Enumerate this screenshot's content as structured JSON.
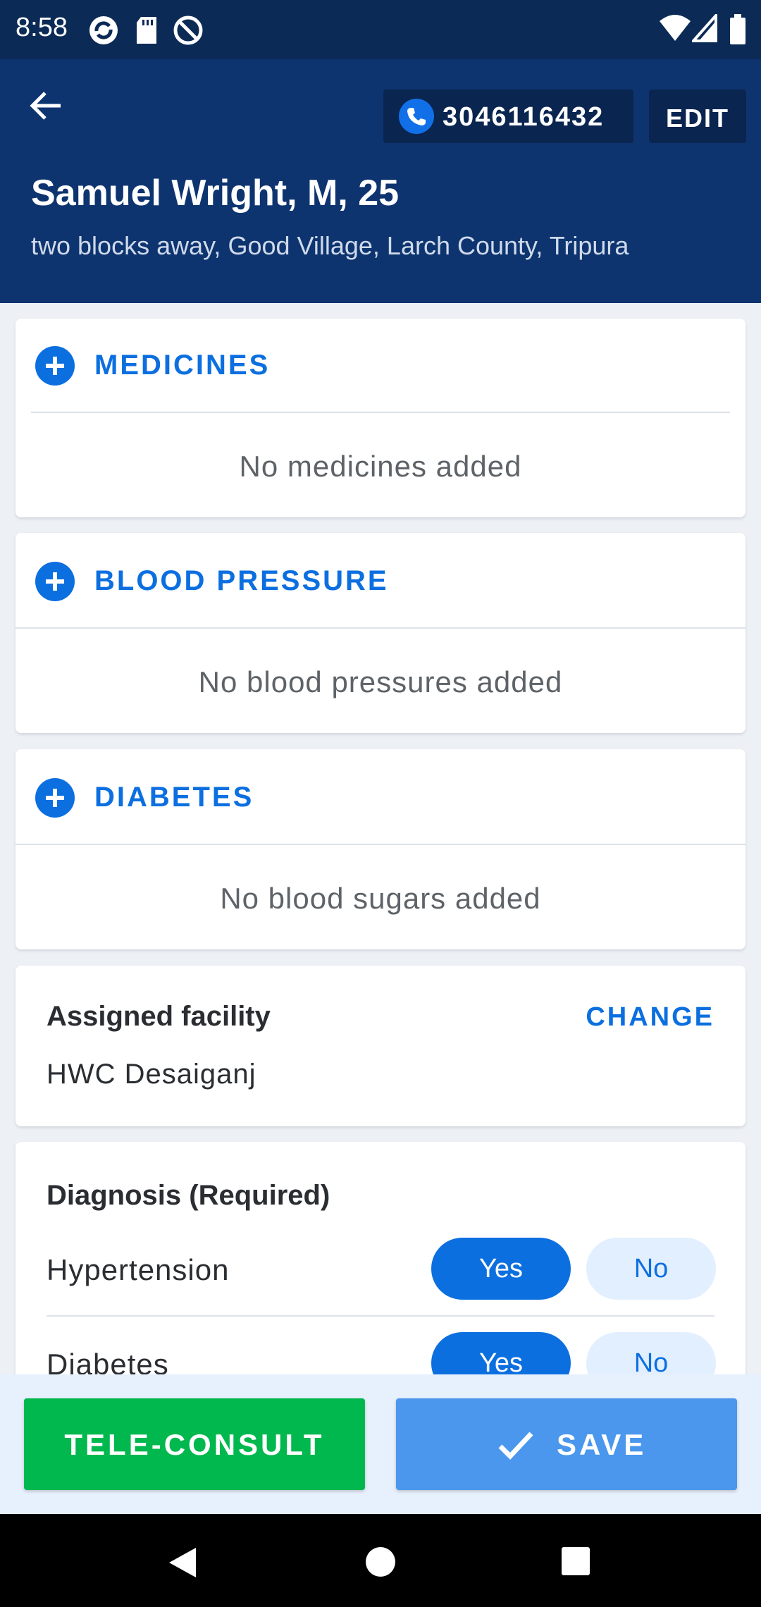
{
  "status_bar": {
    "time": "8:58",
    "left_icons": [
      "sync-icon",
      "sd-card-icon",
      "at-sign-icon"
    ],
    "right_icons": [
      "wifi-icon",
      "signal-icon",
      "battery-icon"
    ]
  },
  "header": {
    "back_icon": "arrow-left-icon",
    "phone_number": "3046116432",
    "edit_label": "EDIT",
    "patient_name": "Samuel Wright, M, 25",
    "patient_address": "two blocks away, Good Village, Larch County, Tripura"
  },
  "medicines": {
    "title": "MEDICINES",
    "empty_text": "No medicines added"
  },
  "blood_pressure": {
    "title": "BLOOD PRESSURE",
    "empty_text": "No blood pressures added"
  },
  "diabetes": {
    "title": "DIABETES",
    "empty_text": "No blood sugars added"
  },
  "facility": {
    "label": "Assigned facility",
    "change_label": "CHANGE",
    "value": "HWC Desaiganj"
  },
  "diagnosis": {
    "title": "Diagnosis (Required)",
    "rows": [
      {
        "label": "Hypertension",
        "yes": "Yes",
        "no": "No",
        "selected": "Yes"
      },
      {
        "label": "Diabetes",
        "yes": "Yes",
        "no": "No",
        "selected": "Yes"
      }
    ]
  },
  "actions": {
    "teleconsult_label": "TELE-CONSULT",
    "save_label": "SAVE"
  },
  "colors": {
    "header": "#0e3470",
    "accent": "#0c6fe0",
    "teleconsult": "#00b84e",
    "save": "#4a97ed"
  }
}
